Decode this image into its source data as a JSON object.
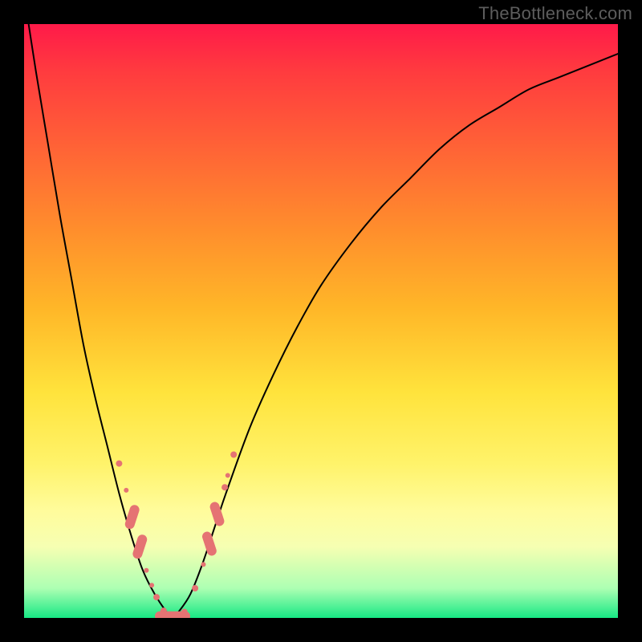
{
  "watermark": "TheBottleneck.com",
  "chart_data": {
    "type": "line",
    "title": "",
    "xlabel": "",
    "ylabel": "",
    "xlim": [
      0,
      100
    ],
    "ylim": [
      0,
      100
    ],
    "curve": {
      "description": "V-shaped bottleneck curve; minimum near x≈25",
      "x": [
        0,
        2,
        4,
        6,
        8,
        10,
        12,
        14,
        16,
        18,
        20,
        22,
        24,
        25,
        26,
        28,
        30,
        32,
        34,
        38,
        42,
        46,
        50,
        55,
        60,
        65,
        70,
        75,
        80,
        85,
        90,
        95,
        100
      ],
      "y": [
        105,
        92,
        80,
        68,
        57,
        46,
        37,
        29,
        21,
        14,
        8,
        4,
        1,
        0,
        1,
        4,
        9,
        15,
        21,
        32,
        41,
        49,
        56,
        63,
        69,
        74,
        79,
        83,
        86,
        89,
        91,
        93,
        95
      ]
    },
    "gradient_colors": {
      "top": "#ff1a49",
      "mid": "#ffe33c",
      "bottom": "#17e884"
    },
    "markers": {
      "left_branch": [
        {
          "x": 16.0,
          "y": 26.0,
          "size": 8
        },
        {
          "x": 17.2,
          "y": 21.5,
          "size": 6
        },
        {
          "x": 18.2,
          "y": 17.0,
          "size": 14,
          "pill": true
        },
        {
          "x": 19.5,
          "y": 12.0,
          "size": 14,
          "pill": true
        },
        {
          "x": 20.6,
          "y": 8.0,
          "size": 6
        },
        {
          "x": 21.5,
          "y": 5.5,
          "size": 6
        },
        {
          "x": 22.3,
          "y": 3.5,
          "size": 8
        }
      ],
      "minimum": [
        {
          "x": 23.5,
          "y": 1.2,
          "size": 8
        },
        {
          "x": 25.0,
          "y": 0.3,
          "size": 20,
          "pill_h": true
        },
        {
          "x": 27.0,
          "y": 1.0,
          "size": 8
        }
      ],
      "right_branch": [
        {
          "x": 28.8,
          "y": 5.0,
          "size": 8
        },
        {
          "x": 30.2,
          "y": 9.0,
          "size": 6
        },
        {
          "x": 31.2,
          "y": 12.5,
          "size": 14,
          "pill": true
        },
        {
          "x": 32.5,
          "y": 17.5,
          "size": 14,
          "pill": true
        },
        {
          "x": 33.8,
          "y": 22.0,
          "size": 8
        },
        {
          "x": 34.3,
          "y": 24.0,
          "size": 6
        },
        {
          "x": 35.3,
          "y": 27.5,
          "size": 8
        }
      ]
    }
  }
}
